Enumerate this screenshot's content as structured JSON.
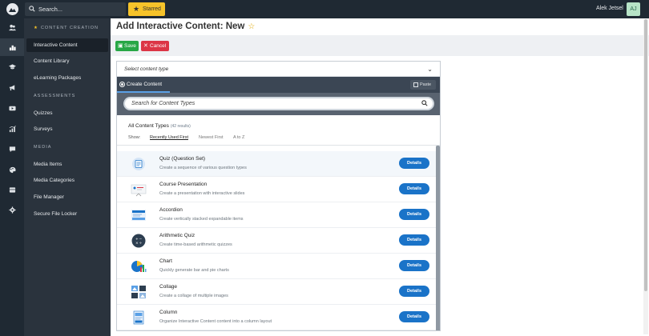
{
  "topbar": {
    "search_placeholder": "Search...",
    "starred_label": "Starred",
    "username": "Alek Jetsel",
    "avatar_initials": "AJ"
  },
  "rail": {
    "icons": [
      "users-icon",
      "content-icon",
      "graduation-icon",
      "megaphone-icon",
      "video-icon",
      "reports-icon",
      "chat-icon",
      "palette-icon",
      "storage-icon",
      "settings-icon"
    ]
  },
  "sidebar": {
    "section_content": "CONTENT CREATION",
    "section_assessments": "ASSESSMENTS",
    "section_media": "MEDIA",
    "items": [
      {
        "label": "Interactive Content"
      },
      {
        "label": "Content Library"
      },
      {
        "label": "eLearning Packages"
      },
      {
        "label": "Quizzes"
      },
      {
        "label": "Surveys"
      },
      {
        "label": "Media Items"
      },
      {
        "label": "Media Categories"
      },
      {
        "label": "File Manager"
      },
      {
        "label": "Secure File Locker"
      }
    ]
  },
  "main": {
    "title": "Add Interactive Content: New",
    "save_label": "Save",
    "cancel_label": "Cancel"
  },
  "panel": {
    "select_label": "Select content type",
    "create_tab": "Create Content",
    "paste_label": "Paste",
    "search_placeholder": "Search for Content Types",
    "list_title": "All Content Types",
    "list_count": "(42 results)",
    "show_label": "Show:",
    "sort_options": [
      "Recently Used First",
      "Newest First",
      "A to Z"
    ],
    "details_label": "Details",
    "types": [
      {
        "name": "Quiz (Question Set)",
        "desc": "Create a sequence of various question types",
        "icon": "quiz-icon"
      },
      {
        "name": "Course Presentation",
        "desc": "Create a presentation with interactive slides",
        "icon": "presentation-icon"
      },
      {
        "name": "Accordion",
        "desc": "Create vertically stacked expandable items",
        "icon": "accordion-icon"
      },
      {
        "name": "Arithmetic Quiz",
        "desc": "Create time-based arithmetic quizzes",
        "icon": "arithmetic-icon"
      },
      {
        "name": "Chart",
        "desc": "Quickly generate bar and pie charts",
        "icon": "chart-icon"
      },
      {
        "name": "Collage",
        "desc": "Create a collage of multiple images",
        "icon": "collage-icon"
      },
      {
        "name": "Column",
        "desc": "Organize Interactive Content content into a column layout",
        "icon": "column-icon"
      }
    ]
  },
  "colors": {
    "dark": "#1f2933",
    "sidebar": "#2a333d",
    "starred": "#f6c32a",
    "save": "#27a745",
    "cancel": "#dc3545",
    "details": "#1a73c8"
  }
}
